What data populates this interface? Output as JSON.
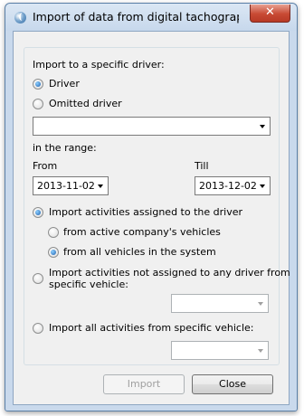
{
  "window": {
    "title": "Import of data from digital tachograph to...",
    "close_glyph": "✕"
  },
  "form": {
    "section_label": "Import to a specific driver:",
    "driver_option": "Driver",
    "omitted_driver_option": "Omitted driver",
    "driver_select_value": "",
    "range_label": "in the range:",
    "from_label": "From",
    "till_label": "Till",
    "from_value": "2013-11-02",
    "till_value": "2013-12-02",
    "assigned_option": "Import activities assigned to the driver",
    "active_company_option": "from active company's vehicles",
    "all_vehicles_option": "from all vehicles in the system",
    "not_assigned_option_line1": "Import activities not assigned to any driver from",
    "not_assigned_option_line2": "specific vehicle:",
    "all_activities_option": "Import all activities from specific vehicle:",
    "vehicle_select_1_value": "",
    "vehicle_select_2_value": ""
  },
  "buttons": {
    "import_label": "Import",
    "close_label": "Close"
  }
}
